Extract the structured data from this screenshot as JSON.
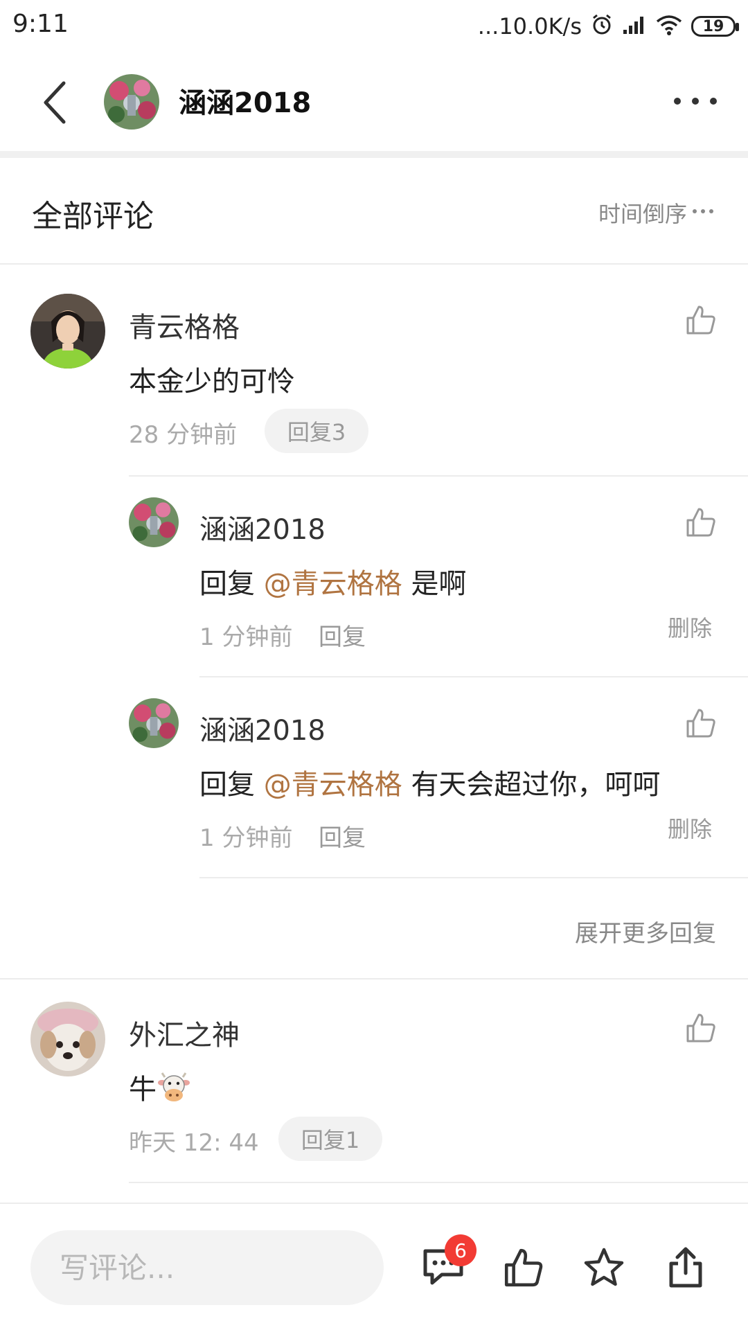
{
  "status_bar": {
    "time": "9:11",
    "network_speed": "...10.0K/s",
    "battery": "19",
    "icons": [
      "alarm-icon",
      "signal-icon",
      "wifi-icon",
      "battery-icon"
    ]
  },
  "nav": {
    "title": "涵涵2018",
    "back_icon": "chevron-left-icon",
    "more_icon": "more-dots-icon"
  },
  "comments_header": {
    "title": "全部评论",
    "sort_label": "时间倒序",
    "sort_icon": "ellipsis-icon"
  },
  "comments": [
    {
      "username": "青云格格",
      "text": "本金少的可怜",
      "time": "28 分钟前",
      "reply_label": "回复3",
      "replies": [
        {
          "username": "涵涵2018",
          "reply_prefix": "回复",
          "mention": "@青云格格",
          "text": "是啊",
          "time": "1 分钟前",
          "reply_label": "回复",
          "delete_label": "删除"
        },
        {
          "username": "涵涵2018",
          "reply_prefix": "回复",
          "mention": "@青云格格",
          "text": "有天会超过你，呵呵",
          "time": "1 分钟前",
          "reply_label": "回复",
          "delete_label": "删除"
        }
      ],
      "expand_label": "展开更多回复"
    },
    {
      "username": "外汇之神",
      "text": "牛",
      "emoji": "cow-face-emoji",
      "time": "昨天 12: 44",
      "reply_label": "回复1"
    }
  ],
  "bottom_bar": {
    "input_placeholder": "写评论...",
    "comment_count_badge": "6",
    "icons": [
      "comment-icon",
      "thumbs-up-icon",
      "star-icon",
      "share-icon"
    ]
  },
  "colors": {
    "mention": "#b07441",
    "badge": "#f23b34",
    "muted_text": "#999999",
    "pill_bg": "#f2f2f2"
  }
}
